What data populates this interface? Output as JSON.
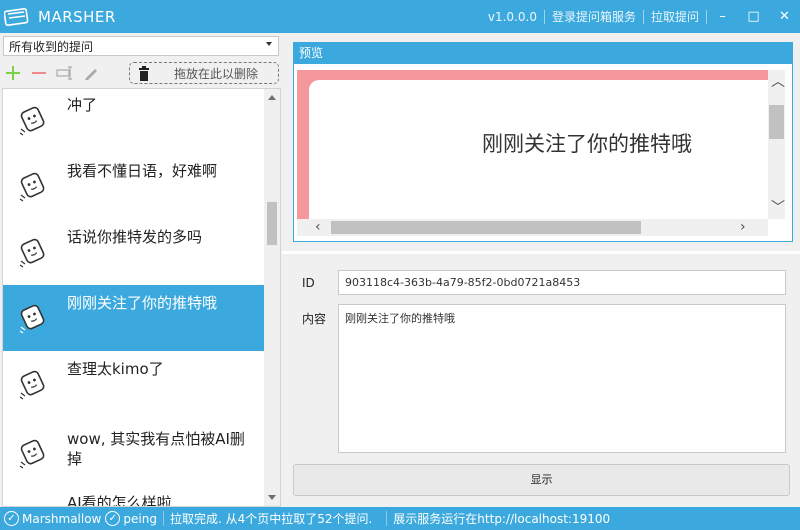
{
  "app": {
    "title": "MARSHER",
    "version": "v1.0.0.0",
    "login_label": "登录提问箱服务",
    "fetch_label": "拉取提问",
    "minimize": "–",
    "maximize": "□",
    "close": "✕"
  },
  "sidebar": {
    "filter_selected": "所有收到的提问",
    "toolbar": {
      "add_icon": "plus-icon",
      "remove_icon": "minus-icon",
      "rename_icon": "text-cursor-icon",
      "edit_icon": "pencil-icon",
      "drop_zone_label": "拖放在此以删除"
    },
    "items": [
      {
        "text": "冲了"
      },
      {
        "text": "我看不懂日语，好难啊"
      },
      {
        "text": "话说你推特发的多吗"
      },
      {
        "text": "刚刚关注了你的推特哦",
        "selected": true
      },
      {
        "text": "查理太kimo了"
      },
      {
        "text": "wow, 其实我有点怕被AI删掉"
      },
      {
        "text": "AI看的怎么样啦"
      }
    ]
  },
  "preview": {
    "header": "预览",
    "text": "刚刚关注了你的推特哦"
  },
  "detail": {
    "id_label": "ID",
    "id_value": "903118c4-363b-4a79-85f2-0bd0721a8453",
    "content_label": "内容",
    "content_value": "刚刚关注了你的推特哦",
    "show_button": "显示"
  },
  "status": {
    "user1": "Marshmallow",
    "user2": "peing",
    "fetch_status": "拉取完成. 从4个页中拉取了52个提问.",
    "server_status": "展示服务运行在http://localhost:19100"
  },
  "colors": {
    "accent": "#3ca9de",
    "preview_background": "#f4989c",
    "add_green": "#7bd14a",
    "remove_red": "#f08a8a"
  }
}
